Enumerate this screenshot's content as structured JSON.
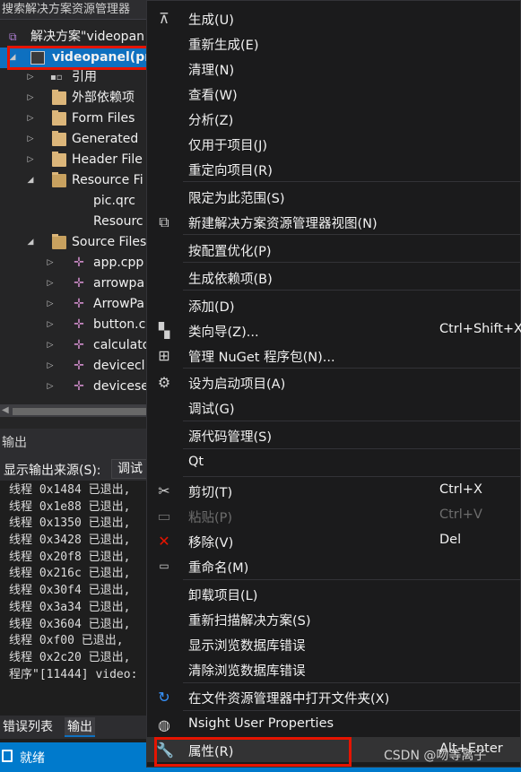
{
  "solution_explorer": {
    "title": "搜索解决方案资源管理器",
    "solution_label": "解决方案\"videopan",
    "project_label": "videopanel(pr",
    "items": [
      {
        "label": "引用"
      },
      {
        "label": "外部依赖项"
      },
      {
        "label": "Form Files"
      },
      {
        "label": "Generated"
      },
      {
        "label": "Header File"
      },
      {
        "label": "Resource Fi"
      },
      {
        "label": "pic.qrc"
      },
      {
        "label": "Resourc"
      },
      {
        "label": "Source Files"
      },
      {
        "label": "app.cpp"
      },
      {
        "label": "arrowpa"
      },
      {
        "label": "ArrowPa"
      },
      {
        "label": "button.c"
      },
      {
        "label": "calculato"
      },
      {
        "label": "devicecl"
      },
      {
        "label": "devicese"
      }
    ]
  },
  "output": {
    "title": "输出",
    "source_label": "显示输出来源(S):",
    "source_value": "调试",
    "lines": [
      "线程 0x1484 已退出,",
      "线程 0x1e88 已退出,",
      "线程 0x1350 已退出,",
      "线程 0x3428 已退出,",
      "线程 0x20f8 已退出,",
      "线程 0x216c 已退出,",
      "线程 0x30f4 已退出,",
      "线程 0x3a34 已退出,",
      "线程 0x3604 已退出,",
      "线程 0xf00 已退出,",
      "线程 0x2c20 已退出,",
      "程序\"[11444] video:"
    ]
  },
  "bottom_tabs": {
    "errors": "错误列表",
    "output": "输出"
  },
  "status_bar": {
    "text": "就绪"
  },
  "watermark": "CSDN @吻等离子",
  "context_menu": {
    "items": [
      {
        "label": "生成(U)",
        "icon": "build-icon",
        "shortcut": ""
      },
      {
        "label": "重新生成(E)",
        "icon": "",
        "shortcut": ""
      },
      {
        "label": "清理(N)",
        "icon": "",
        "shortcut": ""
      },
      {
        "label": "查看(W)",
        "icon": "",
        "shortcut": ""
      },
      {
        "label": "分析(Z)",
        "icon": "",
        "shortcut": ""
      },
      {
        "label": "仅用于项目(J)",
        "icon": "",
        "shortcut": ""
      },
      {
        "label": "重定向项目(R)",
        "icon": "",
        "shortcut": ""
      },
      {
        "label": "限定为此范围(S)",
        "icon": "",
        "shortcut": ""
      },
      {
        "label": "新建解决方案资源管理器视图(N)",
        "icon": "new-view-icon",
        "shortcut": ""
      },
      {
        "label": "按配置优化(P)",
        "icon": "",
        "shortcut": ""
      },
      {
        "label": "生成依赖项(B)",
        "icon": "",
        "shortcut": ""
      },
      {
        "label": "添加(D)",
        "icon": "",
        "shortcut": ""
      },
      {
        "label": "类向导(Z)...",
        "icon": "class-wizard-icon",
        "shortcut": "Ctrl+Shift+X"
      },
      {
        "label": "管理 NuGet 程序包(N)...",
        "icon": "nuget-icon",
        "shortcut": ""
      },
      {
        "label": "设为启动项目(A)",
        "icon": "gear-icon",
        "shortcut": ""
      },
      {
        "label": "调试(G)",
        "icon": "",
        "shortcut": ""
      },
      {
        "label": "源代码管理(S)",
        "icon": "",
        "shortcut": ""
      },
      {
        "label": "Qt",
        "icon": "",
        "shortcut": ""
      },
      {
        "label": "剪切(T)",
        "icon": "scissors-icon",
        "shortcut": "Ctrl+X"
      },
      {
        "label": "粘贴(P)",
        "icon": "paste-icon",
        "shortcut": "Ctrl+V",
        "disabled": true
      },
      {
        "label": "移除(V)",
        "icon": "remove-icon",
        "shortcut": "Del"
      },
      {
        "label": "重命名(M)",
        "icon": "rename-icon",
        "shortcut": ""
      },
      {
        "label": "卸载项目(L)",
        "icon": "",
        "shortcut": ""
      },
      {
        "label": "重新扫描解决方案(S)",
        "icon": "",
        "shortcut": ""
      },
      {
        "label": "显示浏览数据库错误",
        "icon": "",
        "shortcut": ""
      },
      {
        "label": "清除浏览数据库错误",
        "icon": "",
        "shortcut": ""
      },
      {
        "label": "在文件资源管理器中打开文件夹(X)",
        "icon": "refresh-icon",
        "shortcut": ""
      },
      {
        "label": "Nsight User Properties",
        "icon": "globe-icon",
        "shortcut": ""
      },
      {
        "label": "属性(R)",
        "icon": "wrench-icon",
        "shortcut": "Alt+Enter"
      }
    ]
  },
  "colors": {
    "accent": "#0e70c0",
    "highlight_box": "#e51400",
    "status_bar": "#007acc"
  }
}
